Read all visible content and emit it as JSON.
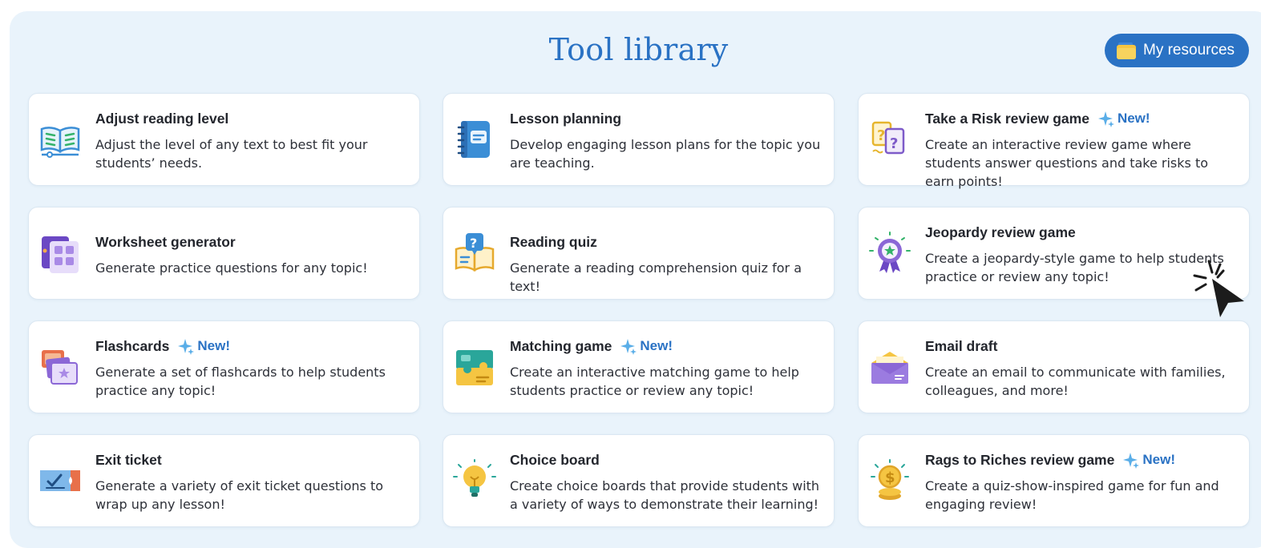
{
  "header": {
    "title": "Tool library",
    "my_resources_label": "My resources"
  },
  "badge_text": "New!",
  "tools": [
    {
      "name": "Adjust reading level",
      "desc": "Adjust the level of any text to best fit your students’ needs.",
      "icon": "open-book-icon",
      "is_new": false
    },
    {
      "name": "Lesson planning",
      "desc": "Develop engaging lesson plans for the topic you are teaching.",
      "icon": "notebook-icon",
      "is_new": false
    },
    {
      "name": "Take a Risk review game",
      "desc": "Create an interactive review game where students answer questions and take risks to earn points!",
      "icon": "question-cards-icon",
      "is_new": true
    },
    {
      "name": "Worksheet generator",
      "desc": "Generate practice questions for any topic!",
      "icon": "worksheet-icon",
      "is_new": false
    },
    {
      "name": "Reading quiz",
      "desc": "Generate a reading comprehension quiz for a text!",
      "icon": "book-question-icon",
      "is_new": false
    },
    {
      "name": "Jeopardy review game",
      "desc": "Create a jeopardy-style game to help students practice or review any topic!",
      "icon": "award-badge-icon",
      "is_new": false
    },
    {
      "name": "Flashcards",
      "desc": "Generate a set of flashcards to help students practice any topic!",
      "icon": "flashcards-icon",
      "is_new": true
    },
    {
      "name": "Matching game",
      "desc": "Create an interactive matching game to help students practice or review any topic!",
      "icon": "puzzle-board-icon",
      "is_new": true
    },
    {
      "name": "Email draft",
      "desc": "Create an email to communicate with families, colleagues, and more!",
      "icon": "envelope-icon",
      "is_new": false
    },
    {
      "name": "Exit ticket",
      "desc": "Generate a variety of exit ticket questions to wrap up any lesson!",
      "icon": "ticket-icon",
      "is_new": false
    },
    {
      "name": "Choice board",
      "desc": "Create choice boards that provide students with a variety of ways to demonstrate their learning!",
      "icon": "lightbulb-icon",
      "is_new": false
    },
    {
      "name": "Rags to Riches review game",
      "desc": "Create a quiz-show-inspired game for fun and engaging review!",
      "icon": "coin-icon",
      "is_new": true
    }
  ],
  "colors": {
    "accent": "#2a72c4",
    "panel_bg": "#e9f3fb",
    "card_bg": "#ffffff"
  }
}
